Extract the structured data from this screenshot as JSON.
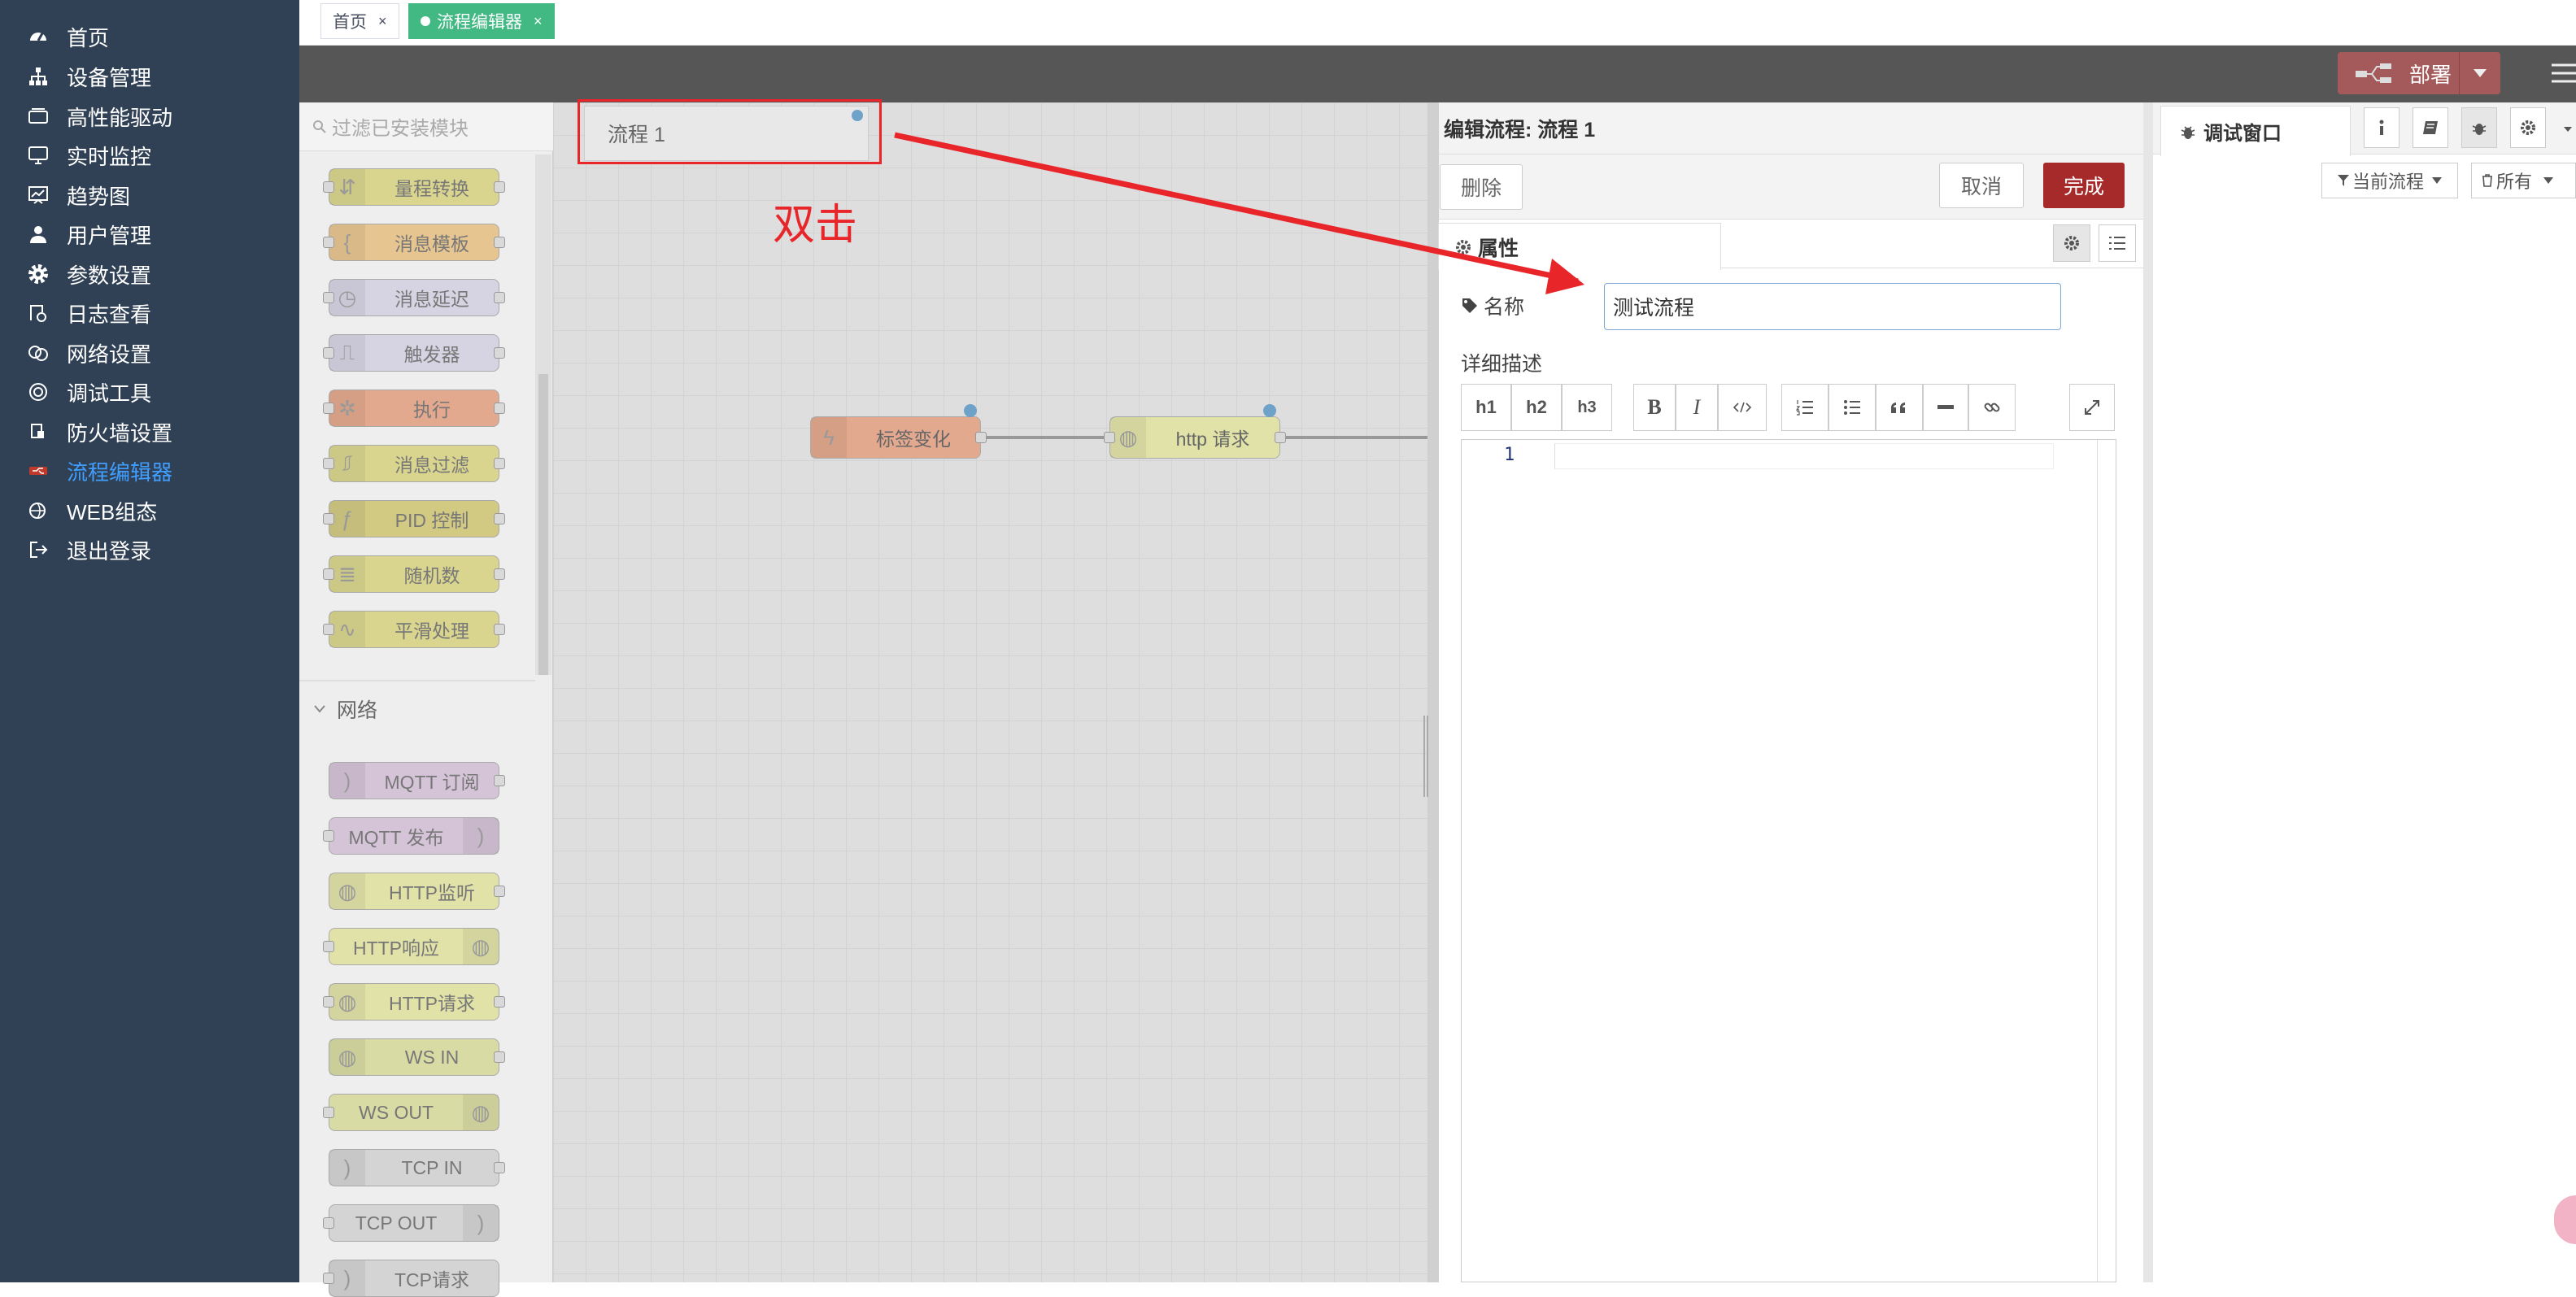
{
  "sidebar": {
    "items": [
      {
        "label": "首页",
        "icon": "dashboard-icon"
      },
      {
        "label": "设备管理",
        "icon": "sitemap-icon"
      },
      {
        "label": "高性能驱动",
        "icon": "server-icon"
      },
      {
        "label": "实时监控",
        "icon": "monitor-icon"
      },
      {
        "label": "趋势图",
        "icon": "chart-icon"
      },
      {
        "label": "用户管理",
        "icon": "user-icon"
      },
      {
        "label": "参数设置",
        "icon": "gear-icon"
      },
      {
        "label": "日志查看",
        "icon": "log-icon"
      },
      {
        "label": "网络设置",
        "icon": "network-icon"
      },
      {
        "label": "调试工具",
        "icon": "lifebuoy-icon"
      },
      {
        "label": "防火墙设置",
        "icon": "firewall-icon"
      },
      {
        "label": "流程编辑器",
        "icon": "flow-icon"
      },
      {
        "label": "WEB组态",
        "icon": "web-icon"
      },
      {
        "label": "退出登录",
        "icon": "logout-icon"
      }
    ],
    "active_index": 11
  },
  "tabs": [
    {
      "label": "首页",
      "close": "×"
    },
    {
      "label": "流程编辑器",
      "close": "×"
    }
  ],
  "header": {
    "deploy_label": "部署"
  },
  "palette": {
    "filter_placeholder": "过滤已安装模块",
    "function_nodes": [
      "量程转换",
      "消息模板",
      "消息延迟",
      "触发器",
      "执行",
      "消息过滤",
      "PID 控制",
      "随机数",
      "平滑处理"
    ],
    "network_category": "网络",
    "network_nodes": [
      "MQTT 订阅",
      "MQTT 发布",
      "HTTP监听",
      "HTTP响应",
      "HTTP请求",
      "WS IN",
      "WS OUT",
      "TCP IN",
      "TCP OUT",
      "TCP请求"
    ]
  },
  "canvas": {
    "flow_tab_label": "流程 1",
    "annotation": "双击",
    "nodes": [
      "标签变化",
      "http 请求"
    ]
  },
  "editor": {
    "title": "编辑流程: 流程 1",
    "delete_label": "删除",
    "cancel_label": "取消",
    "done_label": "完成",
    "properties_tab": "属性",
    "name_label": "名称",
    "name_value": "测试流程",
    "desc_label": "详细描述",
    "toolbar": {
      "h1": "h1",
      "h2": "h2",
      "h3": "h3",
      "bold": "B",
      "italic": "I"
    },
    "line_number": "1"
  },
  "debug": {
    "tab_label": "调试窗口",
    "filter_current": "当前流程",
    "filter_all": "所有"
  },
  "colors": {
    "sidebar_bg": "#304156",
    "active_nav": "#409eff",
    "tab_active": "#42b983",
    "done_button": "#a62a2a",
    "deploy_button": "#a45a5a",
    "annotation_red": "#e8262a"
  }
}
